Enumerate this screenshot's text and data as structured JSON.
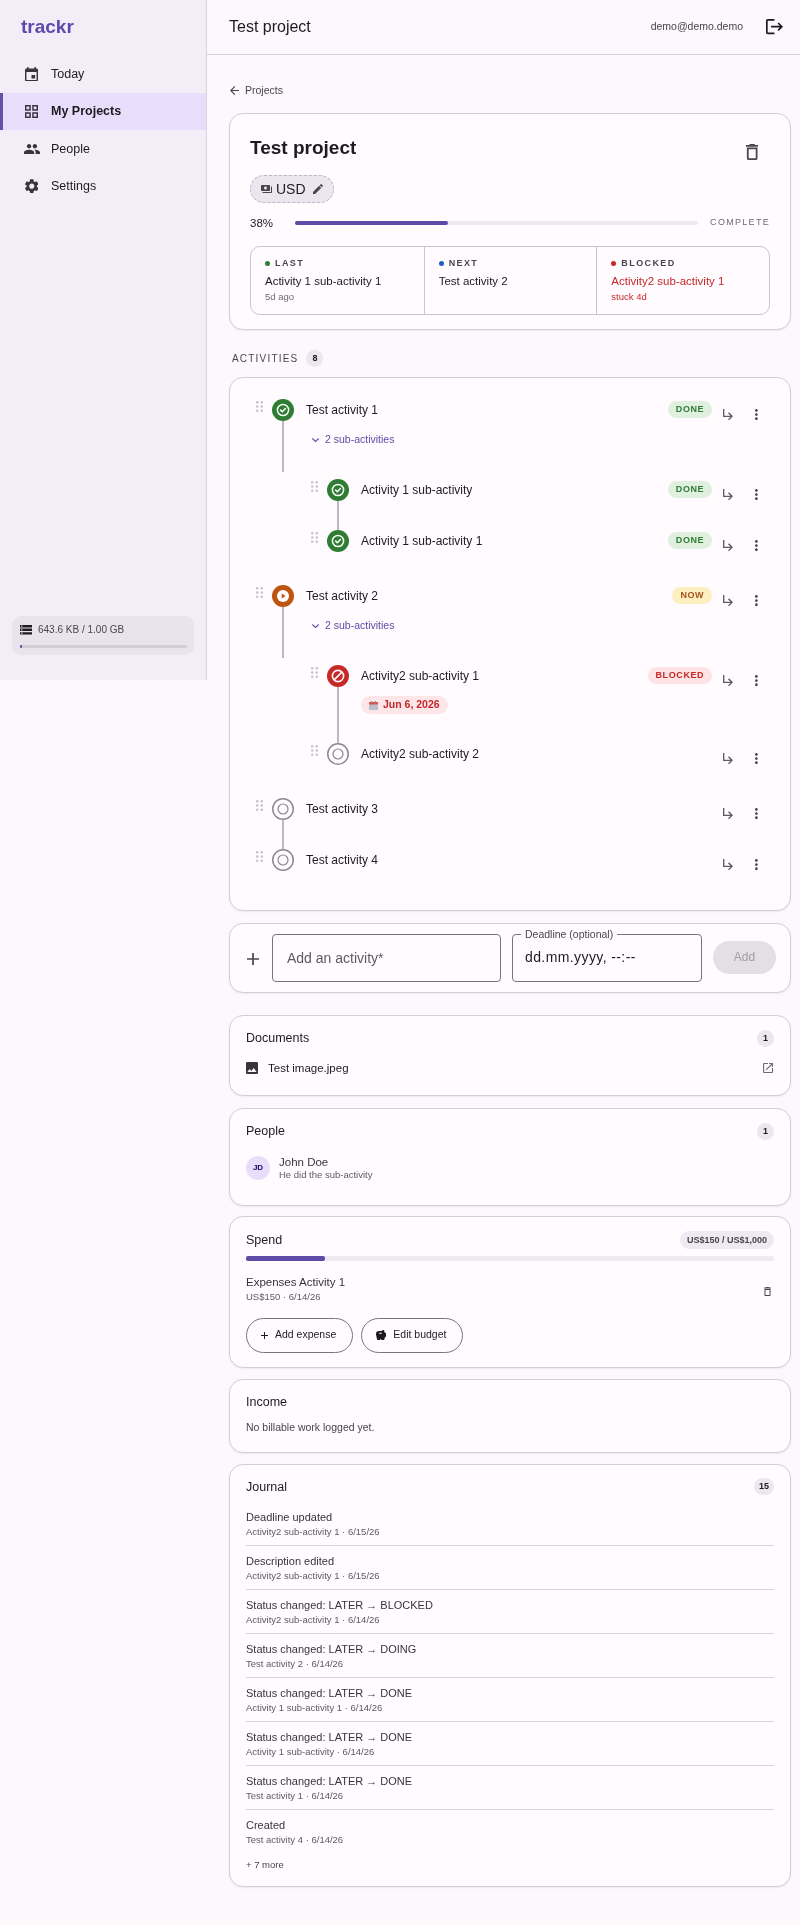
{
  "sidebar": {
    "logo": "trackr",
    "items": [
      {
        "label": "Today",
        "selected": false
      },
      {
        "label": "My Projects",
        "selected": true
      },
      {
        "label": "People",
        "selected": false
      },
      {
        "label": "Settings",
        "selected": false
      }
    ],
    "storage": {
      "text": "643.6 KB / 1.00 GB",
      "level": 0.0006
    }
  },
  "header": {
    "title": "Test project",
    "user": "demo@demo.demo"
  },
  "back_link": "Projects",
  "project": {
    "title": "Test project",
    "currency": "USD",
    "progress": {
      "text": "38%",
      "level": 0.38,
      "label": "COMPLETE"
    },
    "highlights": [
      {
        "label": "LAST",
        "color": "#2e7d32",
        "kind": "plain",
        "activity": "Activity 1 sub-activity 1",
        "note": "5d ago"
      },
      {
        "label": "NEXT",
        "color": "#1e5fc4",
        "kind": "plain",
        "activity": "Test activity 2"
      },
      {
        "label": "BLOCKED",
        "color": "#c62828",
        "kind": "alert",
        "activity": "Activity2 sub-activity 1",
        "note": "stuck 4d"
      }
    ]
  },
  "activities": {
    "heading": "ACTIVITIES",
    "count": "8",
    "items": [
      {
        "title": "Test activity 1",
        "kind": "done",
        "badge": "DONE",
        "subtasks": {
          "label": "2 sub-activities",
          "expanded": true
        },
        "children": [
          {
            "title": "Activity 1 sub-activity",
            "kind": "done",
            "badge": "DONE"
          },
          {
            "title": "Activity 1 sub-activity 1",
            "kind": "done",
            "badge": "DONE"
          }
        ]
      },
      {
        "title": "Test activity 2",
        "kind": "doing",
        "badge": "NOW",
        "subtasks": {
          "label": "2 sub-activities",
          "expanded": true
        },
        "children": [
          {
            "title": "Activity2 sub-activity 1",
            "kind": "blocked",
            "badge": "BLOCKED",
            "deadline": "Jun 6, 2026"
          },
          {
            "title": "Activity2 sub-activity 2",
            "kind": "todo"
          }
        ]
      },
      {
        "title": "Test activity 3",
        "kind": "todo"
      },
      {
        "title": "Test activity 4",
        "kind": "todo"
      }
    ]
  },
  "add_activity": {
    "placeholder": "Add an activity*",
    "deadline": {
      "label": "Deadline (optional)",
      "placeholder": "dd.mm.yyyy, --:--"
    },
    "button": {
      "label": "Add",
      "disabled": true
    }
  },
  "documents": {
    "title": "Documents",
    "count": "1",
    "items": [
      {
        "name": "Test image.jpeg"
      }
    ]
  },
  "people": {
    "title": "People",
    "count": "1",
    "items": [
      {
        "initials": "JD",
        "name": "John Doe",
        "note": "He did the sub-activity"
      }
    ]
  },
  "spend": {
    "title": "Spend",
    "total": "US$150 / US$1,000",
    "level": 0.15,
    "expenses": [
      {
        "name": "Expenses Activity 1",
        "detail": "US$150 · 6/14/26"
      }
    ],
    "buttons": [
      {
        "label": "Add expense",
        "kind": "add"
      },
      {
        "label": "Edit budget",
        "kind": "budget"
      }
    ]
  },
  "income": {
    "title": "Income",
    "message": "No billable work logged yet."
  },
  "journal": {
    "title": "Journal",
    "count": "15",
    "entries": [
      {
        "title": "Deadline updated",
        "detail": "Activity2 sub-activity 1 · 6/15/26"
      },
      {
        "title": "Description edited",
        "detail": "Activity2 sub-activity 1 · 6/15/26"
      },
      {
        "title": "Status changed: LATER → BLOCKED",
        "detail": "Activity2 sub-activity 1 · 6/14/26"
      },
      {
        "title": "Status changed: LATER → DOING",
        "detail": "Test activity 2 · 6/14/26"
      },
      {
        "title": "Status changed: LATER → DONE",
        "detail": "Activity 1 sub-activity 1 · 6/14/26"
      },
      {
        "title": "Status changed: LATER → DONE",
        "detail": "Activity 1 sub-activity · 6/14/26"
      },
      {
        "title": "Status changed: LATER → DONE",
        "detail": "Test activity 1 · 6/14/26"
      },
      {
        "title": "Created",
        "detail": "Test activity 4 · 6/14/26"
      }
    ],
    "more": "+ 7 more"
  }
}
